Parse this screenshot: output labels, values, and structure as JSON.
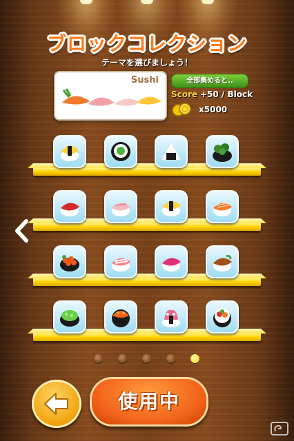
{
  "title": "ブロックコレクション",
  "subtitle": "テーマを選びましょう！",
  "theme": {
    "name": "Sushi",
    "collect_label": "全部集めると..",
    "score_label": "Score",
    "score_value": "+50 / Block",
    "coin_count": "x5000"
  },
  "shelves": [
    {
      "items": [
        "tamago-nigiri-icon",
        "cucumber-roll-icon",
        "onigiri-icon",
        "seaweed-gunkan-icon"
      ]
    },
    {
      "items": [
        "tuna-nigiri-icon",
        "yellowtail-nigiri-icon",
        "tamago-nigiri-icon",
        "salmon-nigiri-icon"
      ]
    },
    {
      "items": [
        "ikura-gunkan-icon",
        "shrimp-nigiri-icon",
        "fatty-tuna-nigiri-icon",
        "eel-nigiri-icon"
      ]
    },
    {
      "items": [
        "green-roe-gunkan-icon",
        "salmon-roe-roll-icon",
        "octopus-nigiri-icon",
        "chirashi-roll-icon"
      ]
    }
  ],
  "page_indicator": {
    "count": 5,
    "active_index": 4
  },
  "buttons": {
    "use_label": "使用中",
    "back_icon": "arrow-left-icon",
    "prev_icon": "chevron-left-icon"
  },
  "colors": {
    "title": "#ff7a1a",
    "shelf": "#ffd400",
    "use_button": "#f2631a",
    "collect_button": "#5aae2a"
  }
}
